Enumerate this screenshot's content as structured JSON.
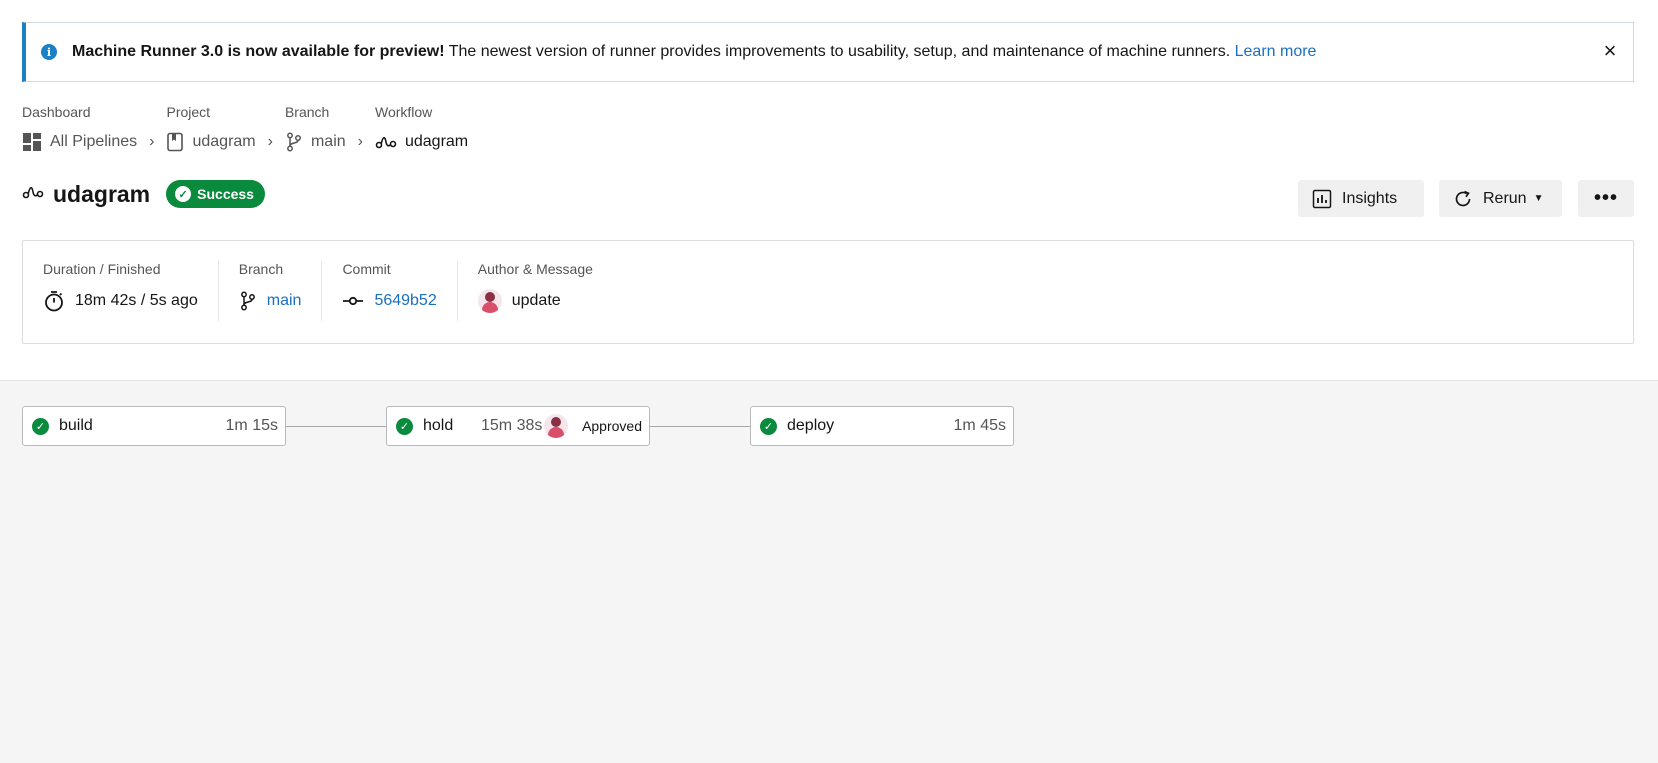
{
  "banner": {
    "title": "Machine Runner 3.0 is now available for preview!",
    "message": "The newest version of runner provides improvements to usability, setup, and maintenance of machine runners.",
    "link": "Learn more",
    "close": "×"
  },
  "breadcrumb": {
    "dashboard": {
      "label": "Dashboard",
      "value": "All Pipelines"
    },
    "project": {
      "label": "Project",
      "value": "udagram"
    },
    "branch": {
      "label": "Branch",
      "value": "main"
    },
    "workflow": {
      "label": "Workflow",
      "value": "udagram"
    }
  },
  "header": {
    "title": "udagram",
    "status": "Success",
    "insights_label": "Insights",
    "rerun_label": "Rerun",
    "more_label": "•••"
  },
  "summary": {
    "duration": {
      "label": "Duration / Finished",
      "value": "18m 42s / 5s ago"
    },
    "branch": {
      "label": "Branch",
      "value": "main"
    },
    "commit": {
      "label": "Commit",
      "value": "5649b52"
    },
    "author": {
      "label": "Author & Message",
      "value": "update"
    }
  },
  "jobs": [
    {
      "name": "build",
      "duration": "1m 15s",
      "status": "success"
    },
    {
      "name": "hold",
      "duration": "15m 38s",
      "status": "success",
      "approval": "Approved"
    },
    {
      "name": "deploy",
      "duration": "1m 45s",
      "status": "success"
    }
  ],
  "colors": {
    "success": "#0a8a3d",
    "link": "#1b6fbe",
    "info": "#1b80c4"
  }
}
